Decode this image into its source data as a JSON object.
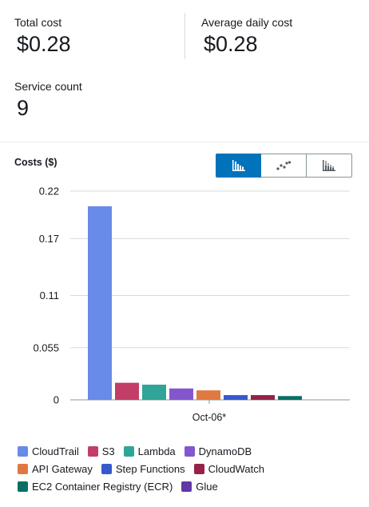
{
  "summary": {
    "total_cost_label": "Total cost",
    "total_cost_value": "$0.28",
    "avg_daily_label": "Average daily cost",
    "avg_daily_value": "$0.28",
    "service_count_label": "Service count",
    "service_count_value": "9"
  },
  "chart_toggle": {
    "options": [
      "bar-chart-icon",
      "line-chart-icon",
      "stacked-bar-chart-icon"
    ],
    "selected": "bar-chart-icon"
  },
  "chart_data": {
    "type": "bar",
    "title": "Costs ($)",
    "xlabel": "",
    "ylabel": "",
    "categories": [
      "Oct-06*"
    ],
    "yticks": [
      "0.22",
      "0.17",
      "0.11",
      "0.055",
      "0"
    ],
    "ylim": [
      0,
      0.22
    ],
    "grid": true,
    "legend_position": "bottom",
    "series": [
      {
        "name": "CloudTrail",
        "values": [
          0.204
        ],
        "color": "#688ae8"
      },
      {
        "name": "S3",
        "values": [
          0.018
        ],
        "color": "#c33d69"
      },
      {
        "name": "Lambda",
        "values": [
          0.016
        ],
        "color": "#2ea597"
      },
      {
        "name": "DynamoDB",
        "values": [
          0.012
        ],
        "color": "#8456ce"
      },
      {
        "name": "API Gateway",
        "values": [
          0.01
        ],
        "color": "#e07941"
      },
      {
        "name": "Step Functions",
        "values": [
          0.005
        ],
        "color": "#3759ce"
      },
      {
        "name": "CloudWatch",
        "values": [
          0.005
        ],
        "color": "#962249"
      },
      {
        "name": "EC2 Container Registry (ECR)",
        "values": [
          0.004
        ],
        "color": "#096f64"
      },
      {
        "name": "Glue",
        "values": [
          0.0
        ],
        "color": "#6237a7"
      }
    ]
  }
}
